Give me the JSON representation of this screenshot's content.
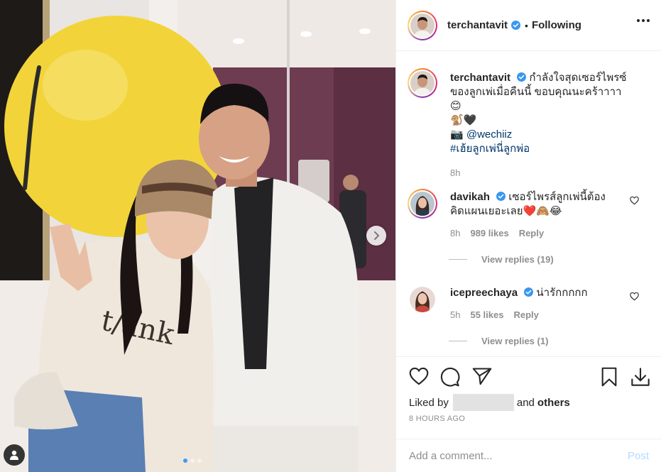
{
  "post": {
    "username": "terchantavit",
    "separator": "•",
    "follow_status": "Following",
    "caption": {
      "line1": "กำลังใจสุดเซอร์ไพรซ์",
      "line2": "ของลูกเพ่เมื่อคืนนี้ ขอบคุณนะคร้าาาา 😊",
      "line3": "🐒🖤",
      "camera": "📷",
      "mention": "@wechiiz",
      "hashtag": "#เฮ้ยลูกเพ่นี่ลูกพ่อ",
      "time": "8h"
    }
  },
  "comments": [
    {
      "username": "davikah",
      "text_line1": "เซอร์ไพรส์ลูกเพ่นี้ต้อง",
      "text_line2": "คิดแผนเยอะเลย❤️🙈😂",
      "time": "8h",
      "likes": "989 likes",
      "reply": "Reply",
      "view_replies": "View replies (19)"
    },
    {
      "username": "icepreechaya",
      "text_line1": "น่ารักกกกก",
      "time": "5h",
      "likes": "55 likes",
      "reply": "Reply",
      "view_replies": "View replies (1)"
    }
  ],
  "actions": {
    "liked_by": "Liked by",
    "and": "and",
    "others": "others",
    "timestamp": "8 HOURS AGO",
    "comment_placeholder": "Add a comment...",
    "post_label": "Post"
  },
  "colors": {
    "verified": "#3897f0",
    "link": "#00376b",
    "muted": "#8e8e8e",
    "post_disabled": "#b3dbff"
  }
}
